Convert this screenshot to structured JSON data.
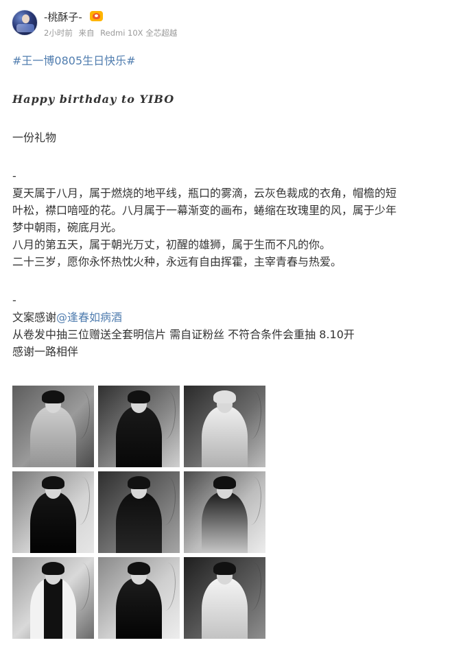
{
  "post": {
    "author": {
      "name": "-桃酥子-",
      "badge_icon": "vip-crown-icon"
    },
    "meta": {
      "time": "2小时前",
      "source_prefix": "来自",
      "source": "Redmi 10X 全芯超越"
    },
    "hashtag": "#王一博0805生日快乐#",
    "english_line": "Happy birthday to YIBO",
    "gift_line": "一份礼物",
    "separator_1": "-",
    "paragraph_lines": [
      "夏天属于八月，属于燃烧的地平线，瓶口的雾滴，云灰色裁成的衣角，帽檐的短",
      "叶松，襟口喑哑的花。八月属于一幕渐变的画布，蜷缩在玫瑰里的风，属于少年",
      "梦中朝雨，碗底月光。",
      "八月的第五天，属于朝光万丈，初醒的雄狮，属于生而不凡的你。",
      "二十三岁，愿你永怀热忱火种，永远有自由挥霍，主宰青春与热爱。"
    ],
    "separator_2": "-",
    "credit_prefix": "文案感谢",
    "credit_mention": "@逢春如病酒",
    "giveaway_line": "从卷发中抽三位赠送全套明信片 需自证粉丝 不符合条件会重抽 8.10开",
    "thanks_line": "感谢一路相伴",
    "image_count": 9
  },
  "colors": {
    "link": "#507daf",
    "text": "#333333",
    "meta": "#999999"
  }
}
